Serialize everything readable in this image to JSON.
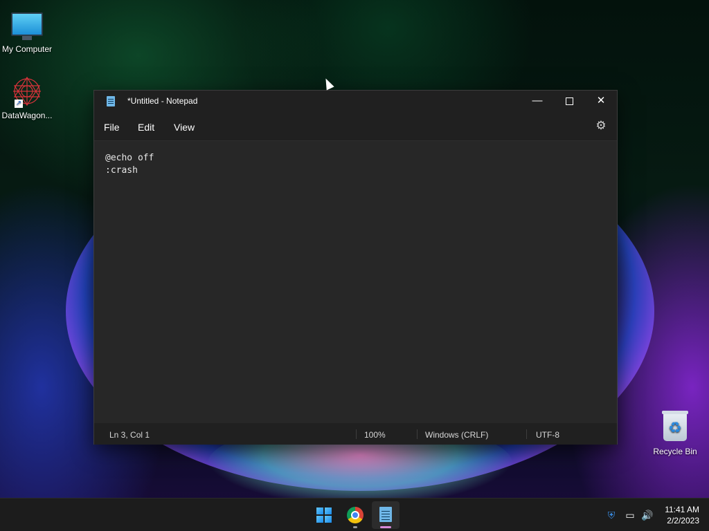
{
  "desktop": {
    "icons": [
      {
        "label": "My Computer",
        "icon": "monitor-icon"
      },
      {
        "label": "DataWagon...",
        "icon": "datawagon-logo-icon"
      },
      {
        "label": "Recycle Bin",
        "icon": "recycle-bin-icon"
      }
    ]
  },
  "notepad": {
    "title": "*Untitled - Notepad",
    "controls": {
      "minimize": "—",
      "close": "✕"
    },
    "menu": {
      "file": "File",
      "edit": "Edit",
      "view": "View"
    },
    "settings_icon": "⚙",
    "content_lines": [
      "@echo off",
      ":crash"
    ],
    "status": {
      "position": "Ln 3, Col 1",
      "zoom": "100%",
      "line_ending": "Windows (CRLF)",
      "encoding": "UTF-8"
    }
  },
  "taskbar": {
    "pinned": [
      "start-icon",
      "chrome-icon",
      "notepad-icon"
    ],
    "tray": {
      "shield": "⛨",
      "network": "▭",
      "volume": "🔊"
    },
    "clock": {
      "time": "11:41 AM",
      "date": "2/2/2023"
    }
  },
  "colors": {
    "window_bg": "#272727",
    "titlebar_bg": "#202020",
    "taskbar_bg": "#1c1c1c",
    "notepad_accent": "#6fb7e8",
    "start_accent": "#1a8ae8"
  }
}
